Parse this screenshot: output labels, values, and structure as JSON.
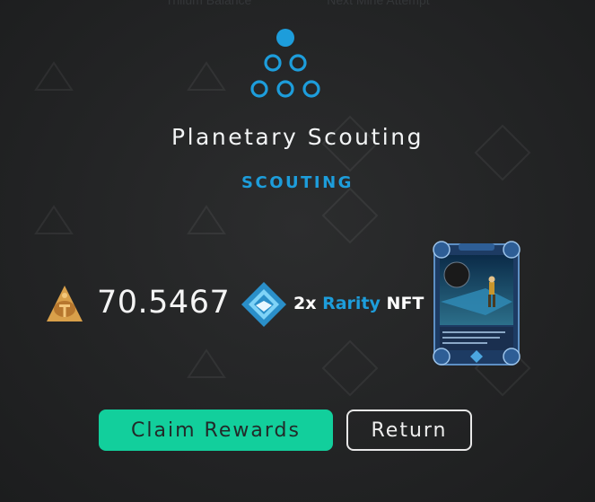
{
  "background_text": {
    "left": "Trilium Balance",
    "right": "Next Mine Attempt"
  },
  "mission": {
    "title": "Planetary Scouting",
    "category": "SCOUTING"
  },
  "rewards": {
    "trilium_amount": "70.5467",
    "nft_count": "2x",
    "nft_rarity": "Rarity",
    "nft_label": "NFT",
    "card_text": "Research - Mysteries await near Planet Binance. Send your ships to gather data and samples."
  },
  "buttons": {
    "claim": "Claim Rewards",
    "return": "Return"
  },
  "colors": {
    "accent_blue": "#1d9ddb",
    "claim_green": "#12cf9c",
    "trilium_gold": "#d9a04a"
  },
  "icons": {
    "logo": "alien-worlds-dots-icon",
    "trilium": "trilium-icon",
    "rarity": "rarity-diamond-icon"
  }
}
